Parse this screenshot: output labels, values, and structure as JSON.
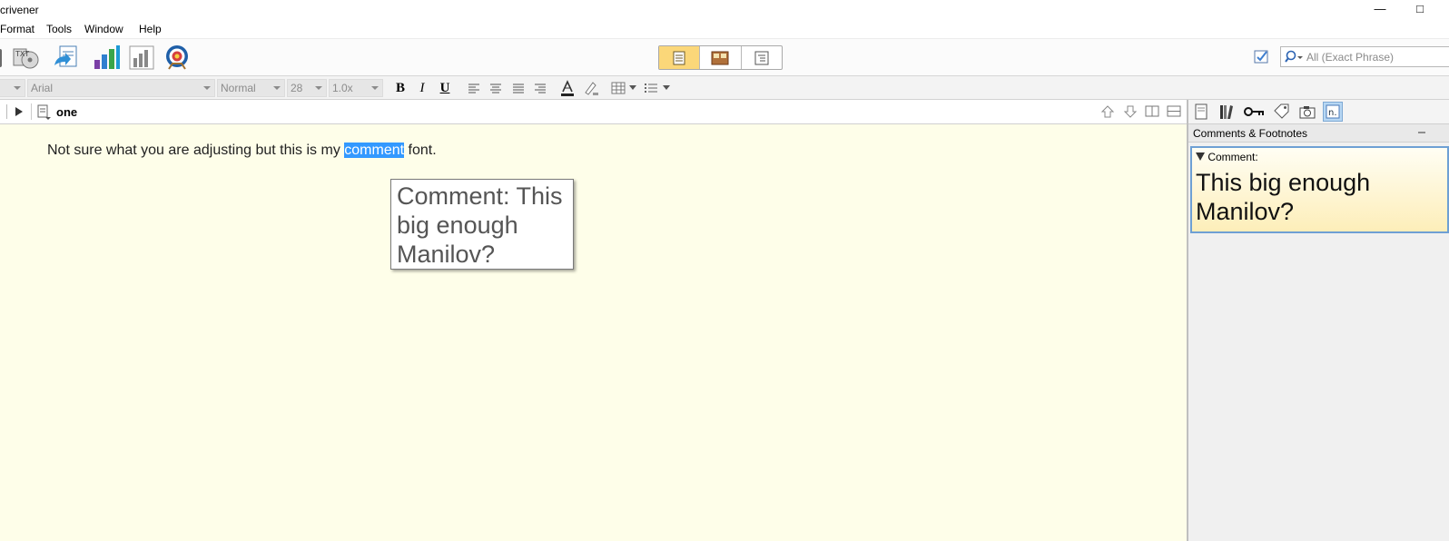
{
  "window": {
    "title": "crivener",
    "minimize_glyph": "—",
    "maximize_glyph": "□"
  },
  "menus": [
    "Format",
    "Tools",
    "Window",
    "Help"
  ],
  "toolbar": {
    "search_placeholder": "All (Exact Phrase)",
    "icons": [
      "compile-icon",
      "backup-icon",
      "import-icon",
      "statistics-icon",
      "text-statistics-icon",
      "project-targets-icon"
    ],
    "view_modes": [
      "single-doc-view-icon",
      "corkboard-view-icon",
      "outliner-view-icon"
    ]
  },
  "formatbar": {
    "font": "Arial",
    "style": "Normal",
    "size": "28",
    "line_spacing": "1.0x",
    "bold": "B",
    "italic": "I",
    "underline": "U"
  },
  "editor": {
    "doc_title": "one",
    "text_before": "Not sure what you are adjusting but this is my ",
    "text_highlight": "comment",
    "text_after": " font.",
    "tooltip": "Comment: This big enough Manilov?"
  },
  "inspector": {
    "panel_title": "Comments & Footnotes",
    "comment_label": "Comment:",
    "comment_text": "This big enough Manilov?"
  },
  "colors": {
    "editor_bg": "#fefee9",
    "highlight": "#3399ff",
    "active_view": "#fbd779"
  }
}
